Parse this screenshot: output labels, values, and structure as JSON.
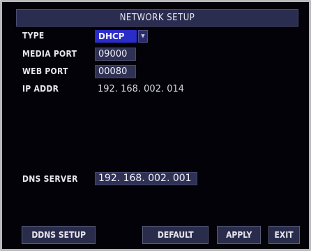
{
  "title": "NETWORK SETUP",
  "fields": {
    "type": {
      "label": "TYPE",
      "value": "DHCP"
    },
    "media_port": {
      "label": "MEDIA PORT",
      "value": "09000"
    },
    "web_port": {
      "label": "WEB PORT",
      "value": "00080"
    },
    "ip_addr": {
      "label": "IP ADDR",
      "value": "192. 168. 002. 014"
    },
    "dns_server": {
      "label": "DNS SERVER",
      "value": "192. 168. 002. 001"
    }
  },
  "buttons": {
    "ddns_setup": "DDNS SETUP",
    "default": "DEFAULT",
    "apply": "APPLY",
    "exit": "EXIT"
  },
  "icons": {
    "dropdown": "chevron-down-icon"
  },
  "colors": {
    "background": "#020208",
    "field": "#2e3054",
    "selected": "#2a2cc8",
    "text": "#e6e6ee"
  }
}
